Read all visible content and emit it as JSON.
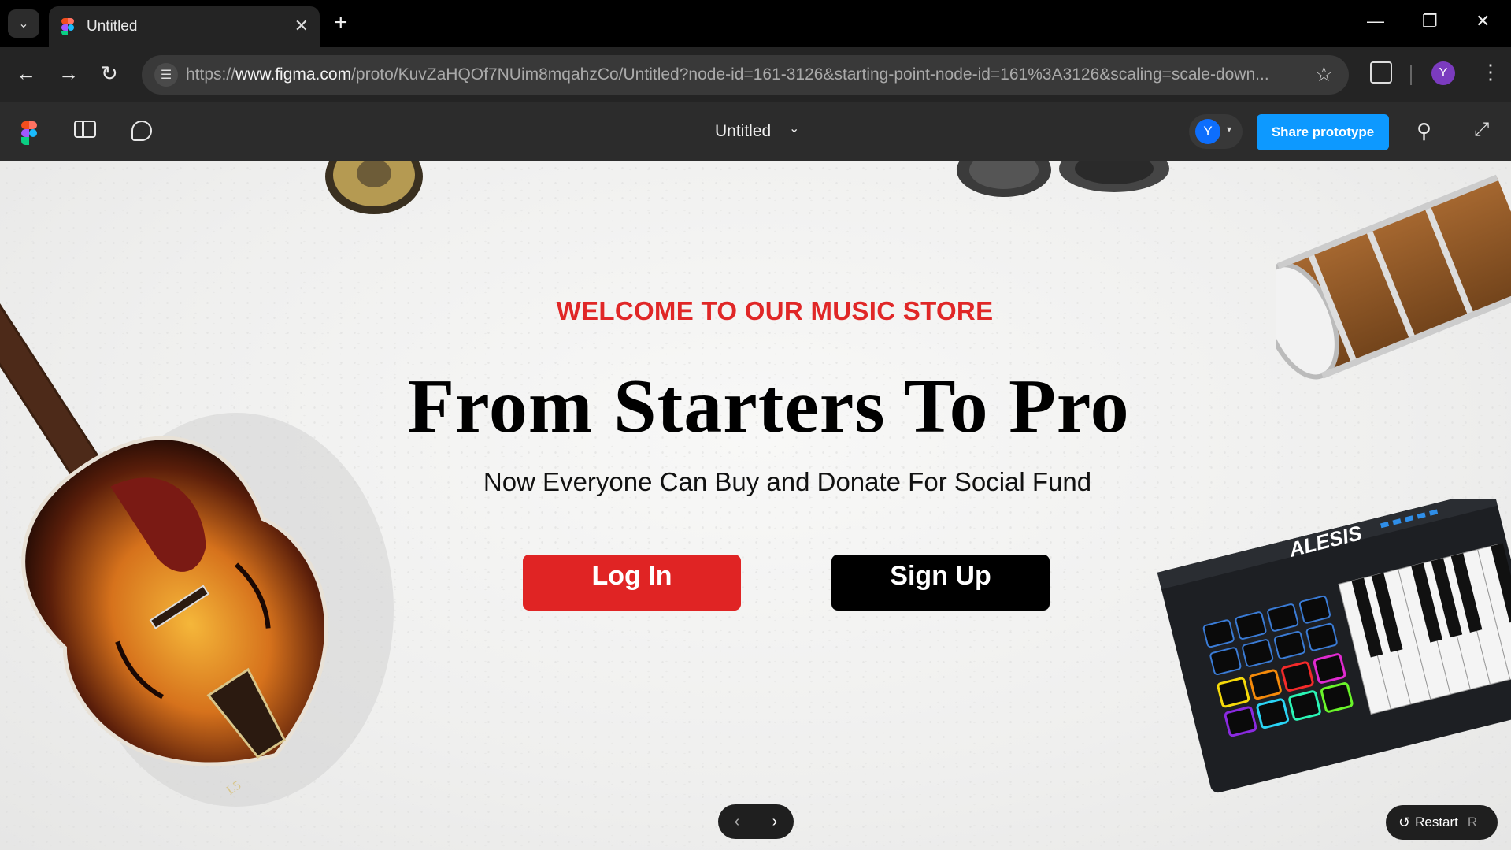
{
  "browser": {
    "tab_title": "Untitled",
    "url_prefix": "https://",
    "url_host": "www.figma.com",
    "url_path": "/proto/KuvZaHQOf7NUim8mqahzCo/Untitled?node-id=161-3126&starting-point-node-id=161%3A3126&scaling=scale-down...",
    "profile_initial": "Y"
  },
  "figma": {
    "file_title": "Untitled",
    "avatar_initial": "Y",
    "share_label": "Share prototype"
  },
  "hero": {
    "welcome": "WELCOME TO OUR MUSIC STORE",
    "headline": "From Starters To Pro",
    "subline": "Now Everyone Can Buy and Donate For Social Fund",
    "login_label": "Log In",
    "signup_label": "Sign Up",
    "keyboard_brand": "ALESIS",
    "guitar_mark": "L5"
  },
  "prototype_controls": {
    "restart_label": "Restart",
    "restart_shortcut": "R"
  },
  "colors": {
    "accent_red": "#e02424",
    "figma_blue": "#0d99ff",
    "avatar_blue": "#0d6efd",
    "profile_purple": "#7b3bbf"
  }
}
